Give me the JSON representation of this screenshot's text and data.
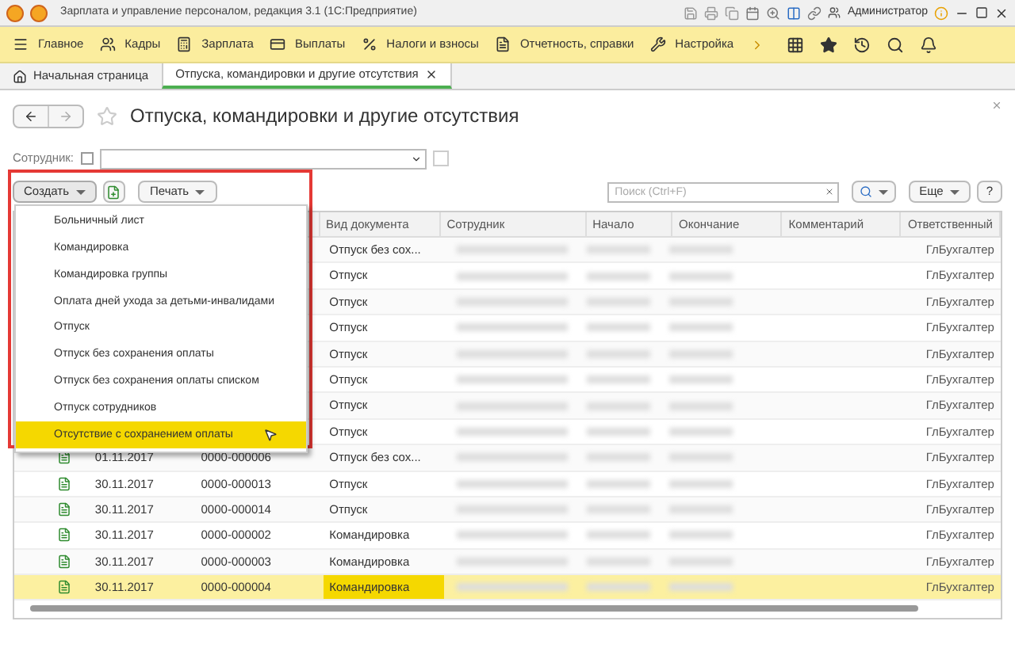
{
  "window": {
    "title": "Зарплата и управление персоналом, редакция 3.1  (1С:Предприятие)",
    "user": "Администратор"
  },
  "sections": [
    {
      "label": "Главное",
      "kind": "menu"
    },
    {
      "label": "Кадры",
      "kind": "people"
    },
    {
      "label": "Зарплата",
      "kind": "calc"
    },
    {
      "label": "Выплаты",
      "kind": "card"
    },
    {
      "label": "Налоги и взносы",
      "kind": "percent"
    },
    {
      "label": "Отчетность, справки",
      "kind": "doc"
    },
    {
      "label": "Настройка",
      "kind": "wrench"
    }
  ],
  "tabs": [
    {
      "label": "Начальная страница",
      "selected": false,
      "kind": "home"
    },
    {
      "label": "Отпуска, командировки и другие отсутствия",
      "selected": true,
      "kind": "doc"
    }
  ],
  "form": {
    "title": "Отпуска, командировки и другие отсутствия",
    "employee_label": "Сотрудник:",
    "employee_filter_checked": false
  },
  "toolbar": {
    "create": "Создать",
    "print": "Печать",
    "search_placeholder": "Поиск (Ctrl+F)",
    "more": "Еще",
    "help": "?"
  },
  "create_menu": [
    {
      "label": "Больничный лист",
      "selected": false
    },
    {
      "label": "Командировка",
      "selected": false
    },
    {
      "label": "Командировка группы",
      "selected": false
    },
    {
      "label": "Оплата дней ухода за детьми-инвалидами",
      "selected": false
    },
    {
      "label": "Отпуск",
      "selected": false
    },
    {
      "label": "Отпуск без сохранения оплаты",
      "selected": false
    },
    {
      "label": "Отпуск без сохранения оплаты списком",
      "selected": false
    },
    {
      "label": "Отпуск сотрудников",
      "selected": false
    },
    {
      "label": "Отсутствие с сохранением оплаты",
      "selected": true
    }
  ],
  "table": {
    "columns": [
      "Вид документа",
      "Сотрудник",
      "Начало",
      "Окончание",
      "Комментарий",
      "Ответственный"
    ],
    "rows": [
      {
        "type": "Отпуск без сох...",
        "responsible": "ГлБухгалтер",
        "selected": false
      },
      {
        "type": "Отпуск",
        "responsible": "ГлБухгалтер",
        "selected": false
      },
      {
        "type": "Отпуск",
        "responsible": "ГлБухгалтер",
        "selected": false
      },
      {
        "type": "Отпуск",
        "responsible": "ГлБухгалтер",
        "selected": false
      },
      {
        "type": "Отпуск",
        "responsible": "ГлБухгалтер",
        "selected": false
      },
      {
        "type": "Отпуск",
        "responsible": "ГлБухгалтер",
        "selected": false
      },
      {
        "type": "Отпуск",
        "responsible": "ГлБухгалтер",
        "selected": false
      },
      {
        "type": "Отпуск",
        "responsible": "ГлБухгалтер",
        "selected": false
      },
      {
        "date": "01.11.2017",
        "number": "0000-000006",
        "type": "Отпуск без сох...",
        "responsible": "ГлБухгалтер",
        "selected": false
      },
      {
        "date": "30.11.2017",
        "number": "0000-000013",
        "type": "Отпуск",
        "responsible": "ГлБухгалтер",
        "selected": false
      },
      {
        "date": "30.11.2017",
        "number": "0000-000014",
        "type": "Отпуск",
        "responsible": "ГлБухгалтер",
        "selected": false
      },
      {
        "date": "30.11.2017",
        "number": "0000-000002",
        "type": "Командировка",
        "responsible": "ГлБухгалтер",
        "selected": false
      },
      {
        "date": "30.11.2017",
        "number": "0000-000003",
        "type": "Командировка",
        "responsible": "ГлБухгалтер",
        "selected": false
      },
      {
        "date": "30.11.2017",
        "number": "0000-000004",
        "type": "Командировка",
        "responsible": "ГлБухгалтер",
        "selected": true
      }
    ]
  }
}
